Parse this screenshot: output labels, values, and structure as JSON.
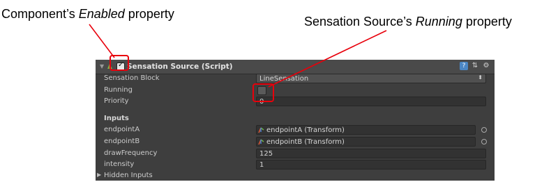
{
  "callouts": {
    "left": {
      "prefix": "Component’s ",
      "emph": "Enabled",
      "suffix": " property"
    },
    "right": {
      "prefix": "Sensation Source’s ",
      "emph": "Running",
      "suffix": " property"
    }
  },
  "colors": {
    "annotation": "#e8000b",
    "panel_bg": "#3e3e3e",
    "header_bg": "#4a4a4a"
  },
  "component": {
    "title": "Sensation Source (Script)",
    "enabled": true,
    "header_icons": [
      "help-book-icon",
      "preset-icon",
      "settings-gear-icon"
    ],
    "settings_glyph": "⚙"
  },
  "properties": {
    "sensation_block": {
      "label": "Sensation Block",
      "value": "LineSensation"
    },
    "running": {
      "label": "Running",
      "checked": false
    },
    "priority": {
      "label": "Priority",
      "value": "0"
    },
    "inputs_header": "Inputs",
    "endpointA": {
      "label": "endpointA",
      "value": "endpointA (Transform)"
    },
    "endpointB": {
      "label": "endpointB",
      "value": "endpointB (Transform)"
    },
    "drawFrequency": {
      "label": "drawFrequency",
      "value": "125"
    },
    "intensity": {
      "label": "intensity",
      "value": "1"
    },
    "hidden_inputs": "Hidden Inputs"
  }
}
